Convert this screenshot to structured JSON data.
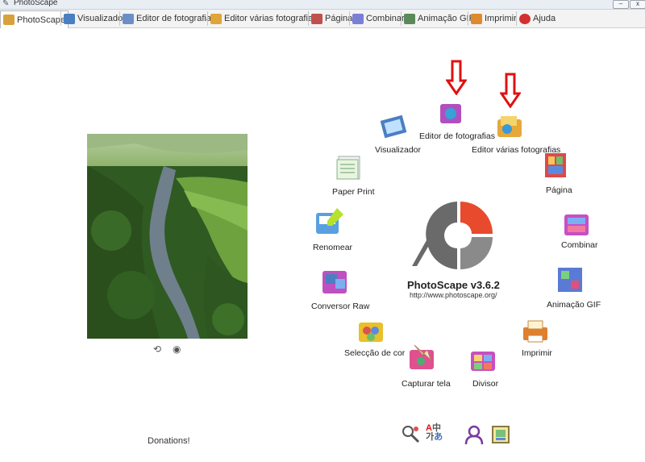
{
  "window": {
    "title": "PhotoScape"
  },
  "tabs": [
    {
      "label": "PhotoScape",
      "color": "#d9a13b"
    },
    {
      "label": "Visualizador",
      "color": "#4a7fc1"
    },
    {
      "label": "Editor de fotografias",
      "color": "#6c8fc7"
    },
    {
      "label": "Editor várias fotografias",
      "color": "#e0a53a"
    },
    {
      "label": "Página",
      "color": "#c0504d"
    },
    {
      "label": "Combinar",
      "color": "#7a7fd6"
    },
    {
      "label": "Animação GIF",
      "color": "#5a8a5a"
    },
    {
      "label": "Imprimir",
      "color": "#e08a30"
    },
    {
      "label": "Ajuda",
      "color": "#d03030"
    }
  ],
  "menu": {
    "visualizador": "Visualizador",
    "editor": "Editor de fotografias",
    "batch": "Editor várias fotografias",
    "pagina": "Página",
    "combinar": "Combinar",
    "gif": "Animação GIF",
    "imprimir": "Imprimir",
    "divisor": "Divisor",
    "capturar": "Capturar tela",
    "seleccao": "Selecção de cor",
    "raw": "Conversor Raw",
    "renomear": "Renomear",
    "paper": "Paper Print"
  },
  "brand": {
    "name": "PhotoScape v3.6.2",
    "url": "http://www.photoscape.org/"
  },
  "donations": "Donations!",
  "colors": {
    "accent": "#e84a2e",
    "logo_gray": "#6a6a6a",
    "arrow": "#e01010"
  }
}
